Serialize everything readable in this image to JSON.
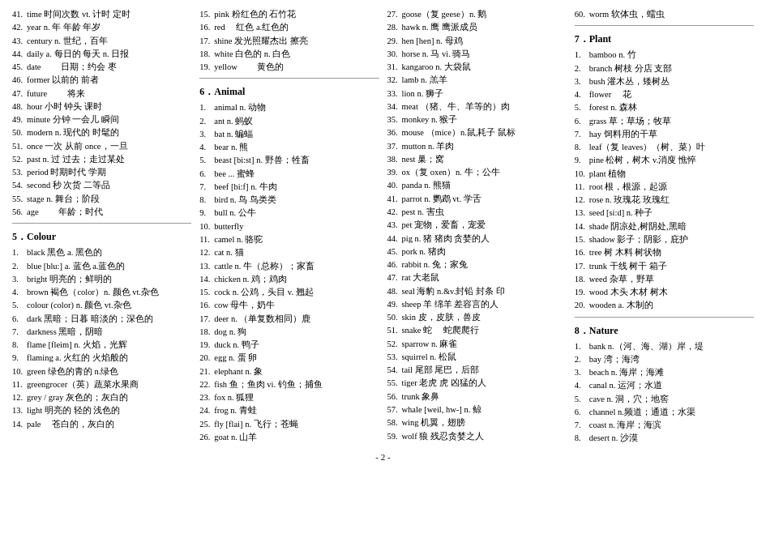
{
  "page_number": "- 2 -",
  "columns": [
    {
      "id": "col1",
      "entries": [
        {
          "num": "41.",
          "text": "time 时间次数 vt. 计时 定时"
        },
        {
          "num": "42.",
          "text": "year n. 年 年龄 年岁"
        },
        {
          "num": "43.",
          "text": "century n. 世纪，百年"
        },
        {
          "num": "44.",
          "text": "daily a. 每日的 每天 n. 日报"
        },
        {
          "num": "45.",
          "text": "date 　　日期；约会 枣"
        },
        {
          "num": "46.",
          "text": "former 以前的 前者"
        },
        {
          "num": "47.",
          "text": "future 　　将来"
        },
        {
          "num": "48.",
          "text": "hour 小时 钟头 课时"
        },
        {
          "num": "49.",
          "text": "minute 分钟 一会儿 瞬间"
        },
        {
          "num": "50.",
          "text": "modern n. 现代的 时髦的"
        },
        {
          "num": "51.",
          "text": "once 一次 从前 once，一旦"
        },
        {
          "num": "52.",
          "text": "past n. 过 过去；走过某处"
        },
        {
          "num": "53.",
          "text": "period 时期时代 学期"
        },
        {
          "num": "54.",
          "text": "second 秒 次货 二等品"
        },
        {
          "num": "55.",
          "text": "stage n. 舞台；阶段"
        },
        {
          "num": "56.",
          "text": "age 　　年龄；时代"
        },
        {
          "num": "",
          "text": ""
        },
        {
          "num": "",
          "text": "5．Colour",
          "isTitle": true
        },
        {
          "num": "1.",
          "text": "black 黑色 a. 黑色的"
        },
        {
          "num": "2.",
          "text": "blue [blu:] a. 蓝色 a.蓝色的"
        },
        {
          "num": "3.",
          "text": "bright 明亮的；鲜明的"
        },
        {
          "num": "4.",
          "text": "brown 褐色（color）n. 颜色 vt.杂色"
        },
        {
          "num": "5.",
          "text": "colour (color) n. 颜色 vt.杂色"
        },
        {
          "num": "6.",
          "text": "dark 黑暗；日暮 暗淡的；深色的"
        },
        {
          "num": "7.",
          "text": "darkness 黑暗，阴暗"
        },
        {
          "num": "8.",
          "text": "flame [fleim] n. 火焰，光辉"
        },
        {
          "num": "9.",
          "text": "flaming a. 火红的 火焰般的"
        },
        {
          "num": "10.",
          "text": "green 绿色的青的 n.绿色"
        },
        {
          "num": "11.",
          "text": "greengrocer（英）蔬菜水果商"
        },
        {
          "num": "12.",
          "text": "grey / gray 灰色的；灰白的"
        },
        {
          "num": "13.",
          "text": "light 明亮的 轻的 浅色的"
        },
        {
          "num": "14.",
          "text": "pale 　苍白的，灰白的"
        }
      ]
    },
    {
      "id": "col2",
      "entries": [
        {
          "num": "15.",
          "text": "pink 粉红色的 石竹花"
        },
        {
          "num": "16.",
          "text": "red 　红色 a.红色的"
        },
        {
          "num": "17.",
          "text": "shine 发光照耀杰出 擦亮"
        },
        {
          "num": "18.",
          "text": "white 白色的 n. 白色"
        },
        {
          "num": "19.",
          "text": "yellow 　　黄色的"
        },
        {
          "num": "",
          "text": ""
        },
        {
          "num": "",
          "text": "6．Animal",
          "isTitle": true
        },
        {
          "num": "1.",
          "text": "animal n. 动物"
        },
        {
          "num": "2.",
          "text": "ant n. 蚂蚁"
        },
        {
          "num": "3.",
          "text": "bat n. 蝙蝠"
        },
        {
          "num": "4.",
          "text": "bear n. 熊"
        },
        {
          "num": "5.",
          "text": "beast [bi:st] n. 野兽；牲畜"
        },
        {
          "num": "6.",
          "text": "bee ... 蜜蜂"
        },
        {
          "num": "7.",
          "text": "beef [bi:f] n. 牛肉"
        },
        {
          "num": "8.",
          "text": "bird n. 鸟 鸟类类"
        },
        {
          "num": "9.",
          "text": "bull n. 公牛"
        },
        {
          "num": "10.",
          "text": "butterfly"
        },
        {
          "num": "11.",
          "text": "camel n. 骆驼"
        },
        {
          "num": "12.",
          "text": "cat n. 猫"
        },
        {
          "num": "13.",
          "text": "cattle n. 牛（总称）；家畜"
        },
        {
          "num": "14.",
          "text": "chicken n. 鸡；鸡肉"
        },
        {
          "num": "15.",
          "text": "cock n. 公鸡，头目 v. 翘起"
        },
        {
          "num": "16.",
          "text": "cow 母牛，奶牛"
        },
        {
          "num": "17.",
          "text": "deer n. （单复数相同）鹿"
        },
        {
          "num": "18.",
          "text": "dog n. 狗"
        },
        {
          "num": "19.",
          "text": "duck n. 鸭子"
        },
        {
          "num": "20.",
          "text": "egg n. 蛋 卵"
        },
        {
          "num": "21.",
          "text": "elephant n. 象"
        },
        {
          "num": "22.",
          "text": "fish 鱼；鱼肉 vi. 钓鱼；捕鱼"
        },
        {
          "num": "23.",
          "text": "fox n. 狐狸"
        },
        {
          "num": "24.",
          "text": "frog n. 青蛙"
        },
        {
          "num": "25.",
          "text": "fly [flai] n. 飞行；苍蝇"
        },
        {
          "num": "26.",
          "text": "goat n. 山羊"
        }
      ]
    },
    {
      "id": "col3",
      "entries": [
        {
          "num": "27.",
          "text": "goose（复 geese）n. 鹅"
        },
        {
          "num": "28.",
          "text": "hawk n. 鹰 鹰派成员"
        },
        {
          "num": "29.",
          "text": "hen [hen] n. 母鸡"
        },
        {
          "num": "30.",
          "text": "horse n. 马 vi. 骑马"
        },
        {
          "num": "31.",
          "text": "kangaroo n. 大袋鼠"
        },
        {
          "num": "32.",
          "text": "lamb n. 羔羊"
        },
        {
          "num": "33.",
          "text": "lion n. 狮子"
        },
        {
          "num": "34.",
          "text": "meat （猪、牛、羊等的）肉"
        },
        {
          "num": "35.",
          "text": "monkey n. 猴子"
        },
        {
          "num": "36.",
          "text": "mouse （mice）n.鼠,耗子 鼠标"
        },
        {
          "num": "37.",
          "text": "mutton n. 羊肉"
        },
        {
          "num": "38.",
          "text": "nest 巢；窝"
        },
        {
          "num": "39.",
          "text": "ox（复 oxen）n. 牛；公牛"
        },
        {
          "num": "40.",
          "text": "panda n. 熊猫"
        },
        {
          "num": "41.",
          "text": "parrot n. 鹦鹉 vt. 学舌"
        },
        {
          "num": "42.",
          "text": "pest n. 害虫"
        },
        {
          "num": "43.",
          "text": "pet 宠物，爱畜，宠爱"
        },
        {
          "num": "44.",
          "text": "pig n. 猪 猪肉 贪婪的人"
        },
        {
          "num": "45.",
          "text": "pork n. 猪肉"
        },
        {
          "num": "46.",
          "text": "rabbit n. 兔；家兔"
        },
        {
          "num": "47.",
          "text": "rat 大老鼠"
        },
        {
          "num": "48.",
          "text": "seal 海豹 n.&v.封铅 封条 印"
        },
        {
          "num": "49.",
          "text": "sheep 羊 绵羊 差容言的人"
        },
        {
          "num": "50.",
          "text": "skin 皮，皮肤，兽皮"
        },
        {
          "num": "51.",
          "text": "snake 蛇 　蛇爬爬行"
        },
        {
          "num": "52.",
          "text": "sparrow n. 麻雀"
        },
        {
          "num": "53.",
          "text": "squirrel n. 松鼠"
        },
        {
          "num": "54.",
          "text": "tail 尾部 尾巴，后部"
        },
        {
          "num": "55.",
          "text": "tiger 老虎 虎 凶猛的人"
        },
        {
          "num": "56.",
          "text": "trunk 象鼻"
        },
        {
          "num": "57.",
          "text": "whale [weil, hw-] n. 鲸"
        },
        {
          "num": "58.",
          "text": "wing 机翼，翅膀"
        },
        {
          "num": "59.",
          "text": "wolf 狼 残忍贪婪之人"
        }
      ]
    },
    {
      "id": "col4",
      "entries": [
        {
          "num": "60.",
          "text": "worm 软体虫，蠕虫"
        },
        {
          "num": "",
          "text": ""
        },
        {
          "num": "",
          "text": "7．Plant",
          "isTitle": true
        },
        {
          "num": "1.",
          "text": "bamboo n. 竹"
        },
        {
          "num": "2.",
          "text": "branch 树枝 分店 支部"
        },
        {
          "num": "3.",
          "text": "bush 灌木丛，矮树丛"
        },
        {
          "num": "4.",
          "text": "flower 　花"
        },
        {
          "num": "5.",
          "text": "forest n. 森林"
        },
        {
          "num": "6.",
          "text": "grass 草；草场；牧草"
        },
        {
          "num": "7.",
          "text": "hay 饲料用的干草"
        },
        {
          "num": "8.",
          "text": "leaf（复 leaves）（树、菜）叶"
        },
        {
          "num": "9.",
          "text": "pine 松树，树木 v.消廋 憔悴"
        },
        {
          "num": "10.",
          "text": "plant 植物"
        },
        {
          "num": "11.",
          "text": "root 根，根源，起源"
        },
        {
          "num": "12.",
          "text": "rose n. 玫瑰花 玫瑰红"
        },
        {
          "num": "13.",
          "text": "seed [si:d] n. 种子"
        },
        {
          "num": "14.",
          "text": "shade 阴凉处,树阴处,黑暗"
        },
        {
          "num": "15.",
          "text": "shadow 影子；阴影，庇护"
        },
        {
          "num": "16.",
          "text": "tree 树 木料 树状物"
        },
        {
          "num": "17.",
          "text": "trunk 干线 树干 箱子"
        },
        {
          "num": "18.",
          "text": "weed 杂草，野草"
        },
        {
          "num": "19.",
          "text": "wood 木头 木材 树木"
        },
        {
          "num": "20.",
          "text": "wooden a. 木制的"
        },
        {
          "num": "",
          "text": ""
        },
        {
          "num": "",
          "text": "8．Nature",
          "isTitle": true
        },
        {
          "num": "1.",
          "text": "bank n.（河、海、湖）岸，堤"
        },
        {
          "num": "2.",
          "text": "bay 湾；海湾"
        },
        {
          "num": "3.",
          "text": "beach n. 海岸；海滩"
        },
        {
          "num": "4.",
          "text": "canal n. 运河；水道"
        },
        {
          "num": "5.",
          "text": "cave n. 洞，穴；地窖"
        },
        {
          "num": "6.",
          "text": "channel n.频道；通道；水渠"
        },
        {
          "num": "7.",
          "text": "coast n. 海岸；海滨"
        },
        {
          "num": "8.",
          "text": "desert n. 沙漠"
        }
      ]
    }
  ]
}
